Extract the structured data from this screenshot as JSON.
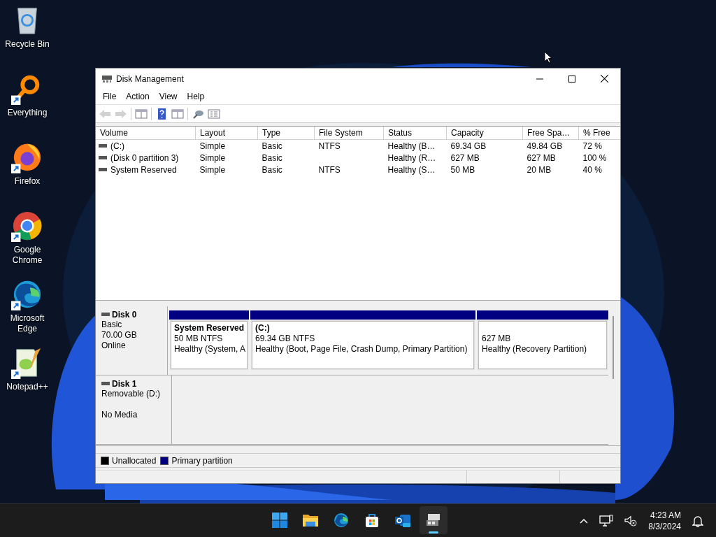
{
  "desktop_icons": [
    {
      "label": "Recycle Bin",
      "kind": "recycle",
      "shortcut": false
    },
    {
      "label": "Everything",
      "kind": "everything",
      "shortcut": true
    },
    {
      "label": "Firefox",
      "kind": "firefox",
      "shortcut": true
    },
    {
      "label": "Google Chrome",
      "kind": "chrome",
      "shortcut": true
    },
    {
      "label": "Microsoft Edge",
      "kind": "edge",
      "shortcut": true
    },
    {
      "label": "Notepad++",
      "kind": "notepad",
      "shortcut": true
    }
  ],
  "window": {
    "title": "Disk Management"
  },
  "menu": [
    "File",
    "Action",
    "View",
    "Help"
  ],
  "toolbar": [
    {
      "kind": "back",
      "disabled": true
    },
    {
      "kind": "forward",
      "disabled": true
    },
    {
      "kind": "sep"
    },
    {
      "kind": "tree",
      "disabled": false
    },
    {
      "kind": "sep"
    },
    {
      "kind": "help",
      "disabled": false
    },
    {
      "kind": "pane",
      "disabled": false
    },
    {
      "kind": "sep"
    },
    {
      "kind": "connect",
      "disabled": false
    },
    {
      "kind": "list",
      "disabled": false
    }
  ],
  "table": {
    "columns": [
      "Volume",
      "Layout",
      "Type",
      "File System",
      "Status",
      "Capacity",
      "Free Spa…",
      "% Free"
    ],
    "rows": [
      [
        "(C:)",
        "Simple",
        "Basic",
        "NTFS",
        "Healthy (B…",
        "69.34 GB",
        "49.84 GB",
        "72 %"
      ],
      [
        "(Disk 0 partition 3)",
        "Simple",
        "Basic",
        "",
        "Healthy (R…",
        "627 MB",
        "627 MB",
        "100 %"
      ],
      [
        "System Reserved",
        "Simple",
        "Basic",
        "NTFS",
        "Healthy (S…",
        "50 MB",
        "20 MB",
        "40 %"
      ]
    ]
  },
  "disks": [
    {
      "name": "Disk 0",
      "lines": [
        "Basic",
        "70.00 GB",
        "Online"
      ],
      "partitions": [
        {
          "name": "System Reserved",
          "size": "50 MB NTFS",
          "status": "Healthy (System, A",
          "color": "#000080"
        },
        {
          "name": "(C:)",
          "size": "69.34 GB NTFS",
          "status": "Healthy (Boot, Page File, Crash Dump, Primary Partition)",
          "color": "#000080"
        },
        {
          "size": "627 MB",
          "status": "Healthy (Recovery Partition)",
          "color": "#000080"
        }
      ]
    },
    {
      "name": "Disk 1",
      "lines": [
        "Removable (D:)"
      ],
      "note": "No Media"
    }
  ],
  "legend": [
    {
      "label": "Unallocated",
      "color": "#000000"
    },
    {
      "label": "Primary partition",
      "color": "#000080"
    }
  ],
  "taskbar": [
    {
      "kind": "start",
      "active": false
    },
    {
      "kind": "explorer",
      "active": false
    },
    {
      "kind": "edge",
      "active": false
    },
    {
      "kind": "store",
      "active": false
    },
    {
      "kind": "outlook",
      "active": false
    },
    {
      "kind": "diskmgmt",
      "active": true
    }
  ],
  "tray": {
    "time": "4:23 AM",
    "date": "8/3/2024"
  }
}
